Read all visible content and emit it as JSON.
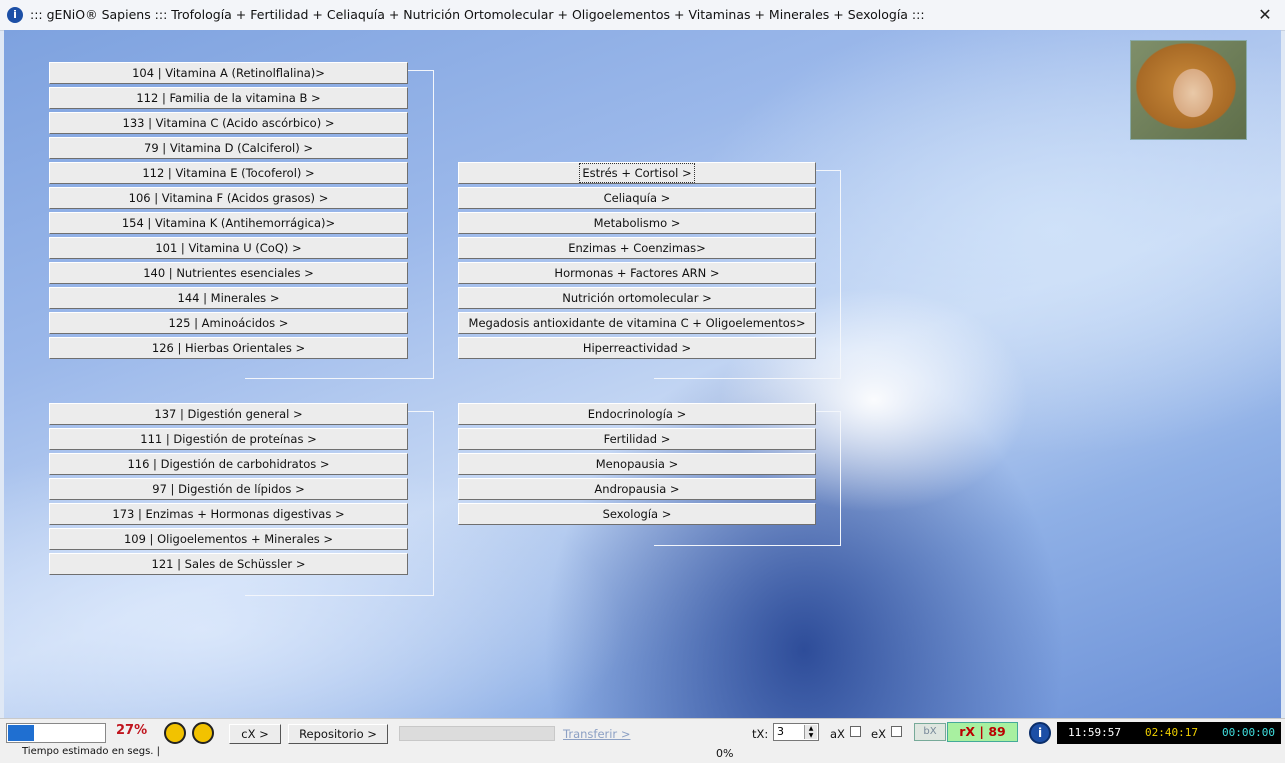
{
  "window": {
    "title": "::: gENiO® Sapiens ::: Trofología + Fertilidad + Celiaquía + Nutrición Ortomolecular + Oligoelementos + Vitaminas + Minerales + Sexología :::",
    "close": "✕",
    "app_icon": "i"
  },
  "groups": {
    "vitamins": [
      "104 | Vitamina A (Retinolflalina)>",
      "112 | Familia de la vitamina B >",
      "133 | Vitamina C (Acido ascórbico) >",
      "79 | Vitamina D (Calciferol) >",
      "112 | Vitamina E (Tocoferol) >",
      "106 | Vitamina F (Acidos grasos) >",
      "154 | Vitamina K (Antihemorrágica)>",
      "101 | Vitamina U (CoQ) >",
      "140 | Nutrientes esenciales >",
      "144 | Minerales >",
      "125 | Aminoácidos >",
      "126 | Hierbas Orientales >"
    ],
    "topics": [
      "Estrés + Cortisol >",
      "Celiaquía >",
      "Metabolismo >",
      "Enzimas + Coenzimas>",
      "Hormonas + Factores ARN >",
      "Nutrición ortomolecular >",
      "Megadosis antioxidante de vitamina C + Oligoelementos>",
      "Hiperreactividad >"
    ],
    "digestion": [
      "137 | Digestión general >",
      "111 | Digestión de proteínas >",
      "116 | Digestión de carbohidratos >",
      "97 | Digestión de lípidos >",
      "173 | Enzimas + Hormonas digestivas >",
      "109 | Oligoelementos + Minerales >",
      "121 | Sales de Schüssler >"
    ],
    "hormonal": [
      "Endocrinología >",
      "Fertilidad >",
      "Menopausia >",
      "Andropausia >",
      "Sexología >"
    ]
  },
  "statusbar": {
    "progress_percent": 27,
    "progress_label": "27%",
    "cx_label": "cX >",
    "repositorio_label": "Repositorio >",
    "transferir_label": "Transferir >",
    "tx_label": "tX:",
    "tx_value": "3",
    "ax_label": "aX",
    "ex_label": "eX",
    "bx_label": "bX",
    "rx_label": "rX | 89",
    "info_icon": "i",
    "time1": "11:59:57",
    "time2": "02:40:17",
    "time3": "00:00:00",
    "time1_color": "#ffffff",
    "time2_color": "#f0d000",
    "time3_color": "#40e0e0",
    "estimate_label": "Tiempo estimado en segs. |",
    "bottom_percent": "0%"
  }
}
